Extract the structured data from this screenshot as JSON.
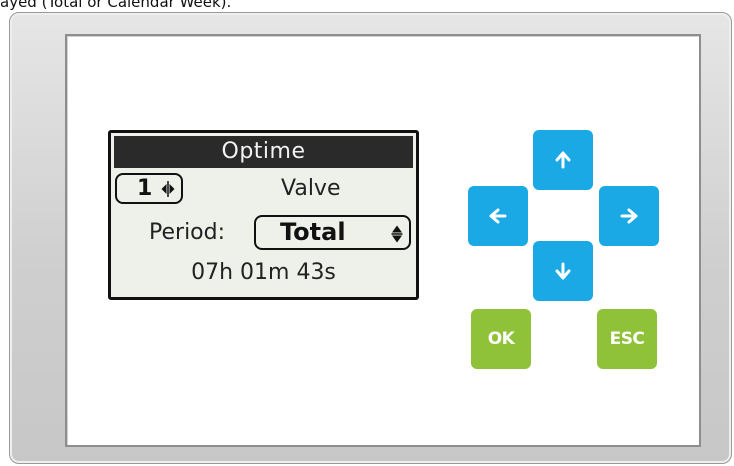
{
  "caption": "ayed (Total or Calendar Week).",
  "screen": {
    "title": "Optime",
    "valve_number": "1",
    "valve_label": "Valve",
    "period_label": "Period:",
    "period_value": "Total",
    "time_value": "07h 01m 43s"
  },
  "buttons": {
    "up": {
      "icon": "arrow-up-icon"
    },
    "left": {
      "icon": "arrow-left-icon"
    },
    "right": {
      "icon": "arrow-right-icon"
    },
    "down": {
      "icon": "arrow-down-icon"
    },
    "ok_label": "OK",
    "esc_label": "ESC"
  },
  "colors": {
    "nav_button": "#1ba9e6",
    "action_button": "#8fc238",
    "lcd_background": "#eef0ea",
    "lcd_title_bar": "#2a2a2a"
  }
}
